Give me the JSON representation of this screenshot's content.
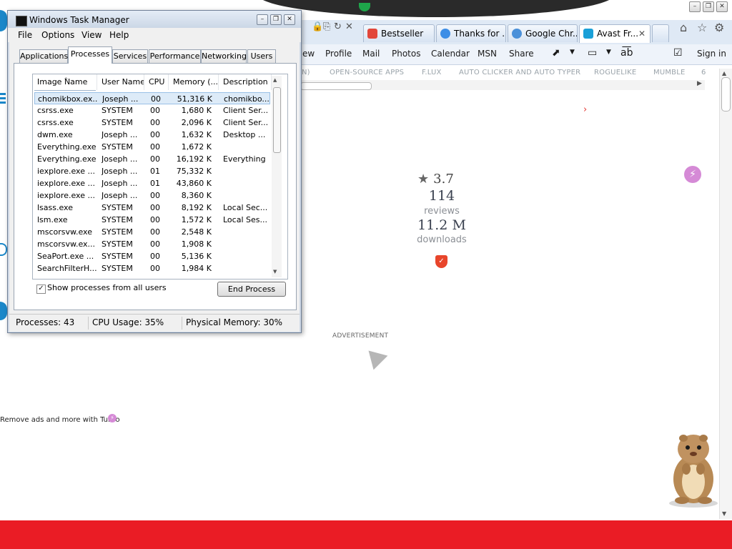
{
  "browser": {
    "tabs": [
      {
        "label": "Bestseller",
        "icon_color": "#e2473b"
      },
      {
        "label": "Thanks for ...",
        "icon_color": "#3d8ee6"
      },
      {
        "label": "Google Chr...",
        "icon_color": "#4a90d9"
      },
      {
        "label": "Avast Fr...",
        "icon_color": "#1aa0d8",
        "active": true
      }
    ],
    "tab_close": "✕",
    "command_bar": [
      "ew",
      "Profile",
      "Mail",
      "Photos",
      "Calendar",
      "MSN",
      "Share",
      "Sign in"
    ],
    "site_nav": [
      "N)",
      "OPEN-SOURCE APPS",
      "F.LUX",
      "AUTO CLICKER AND AUTO TYPER",
      "ROGUELIKE",
      "MUMBLE",
      "6"
    ]
  },
  "app_page": {
    "rating": "3.7",
    "reviews_count": "114",
    "reviews_label": "reviews",
    "downloads_count": "11.2 M",
    "downloads_label": "downloads",
    "advertisement": "ADVERTISEMENT",
    "remove_ads": "Remove ads and more with Turbo"
  },
  "task_manager": {
    "title": "Windows Task Manager",
    "menu": [
      "File",
      "Options",
      "View",
      "Help"
    ],
    "tabs": [
      "Applications",
      "Processes",
      "Services",
      "Performance",
      "Networking",
      "Users"
    ],
    "active_tab": "Processes",
    "columns": [
      "Image Name",
      "User Name",
      "CPU",
      "Memory (...",
      "Description"
    ],
    "rows": [
      [
        "chomikbox.ex...",
        "Joseph ...",
        "00",
        "51,316 K",
        "chomikbo..."
      ],
      [
        "csrss.exe",
        "SYSTEM",
        "00",
        "1,680 K",
        "Client Ser..."
      ],
      [
        "csrss.exe",
        "SYSTEM",
        "00",
        "2,096 K",
        "Client Ser..."
      ],
      [
        "dwm.exe",
        "Joseph ...",
        "00",
        "1,632 K",
        "Desktop ..."
      ],
      [
        "Everything.exe",
        "SYSTEM",
        "00",
        "1,672 K",
        ""
      ],
      [
        "Everything.exe",
        "Joseph ...",
        "00",
        "16,192 K",
        "Everything"
      ],
      [
        "iexplore.exe ...",
        "Joseph ...",
        "01",
        "75,332 K",
        ""
      ],
      [
        "iexplore.exe ...",
        "Joseph ...",
        "01",
        "43,860 K",
        ""
      ],
      [
        "iexplore.exe ...",
        "Joseph ...",
        "00",
        "8,360 K",
        ""
      ],
      [
        "lsass.exe",
        "SYSTEM",
        "00",
        "8,192 K",
        "Local Sec..."
      ],
      [
        "lsm.exe",
        "SYSTEM",
        "00",
        "1,572 K",
        "Local Ses..."
      ],
      [
        "mscorsvw.exe",
        "SYSTEM",
        "00",
        "2,548 K",
        ""
      ],
      [
        "mscorsvw.ex...",
        "SYSTEM",
        "00",
        "1,908 K",
        ""
      ],
      [
        "SeaPort.exe ...",
        "SYSTEM",
        "00",
        "5,136 K",
        ""
      ],
      [
        "SearchFilterH...",
        "SYSTEM",
        "00",
        "1,984 K",
        ""
      ]
    ],
    "show_all_label": "Show processes from all users",
    "show_all_checked": true,
    "end_process": "End Process",
    "status": {
      "processes": "Processes: 43",
      "cpu": "CPU Usage: 35%",
      "memory": "Physical Memory: 30%"
    }
  }
}
